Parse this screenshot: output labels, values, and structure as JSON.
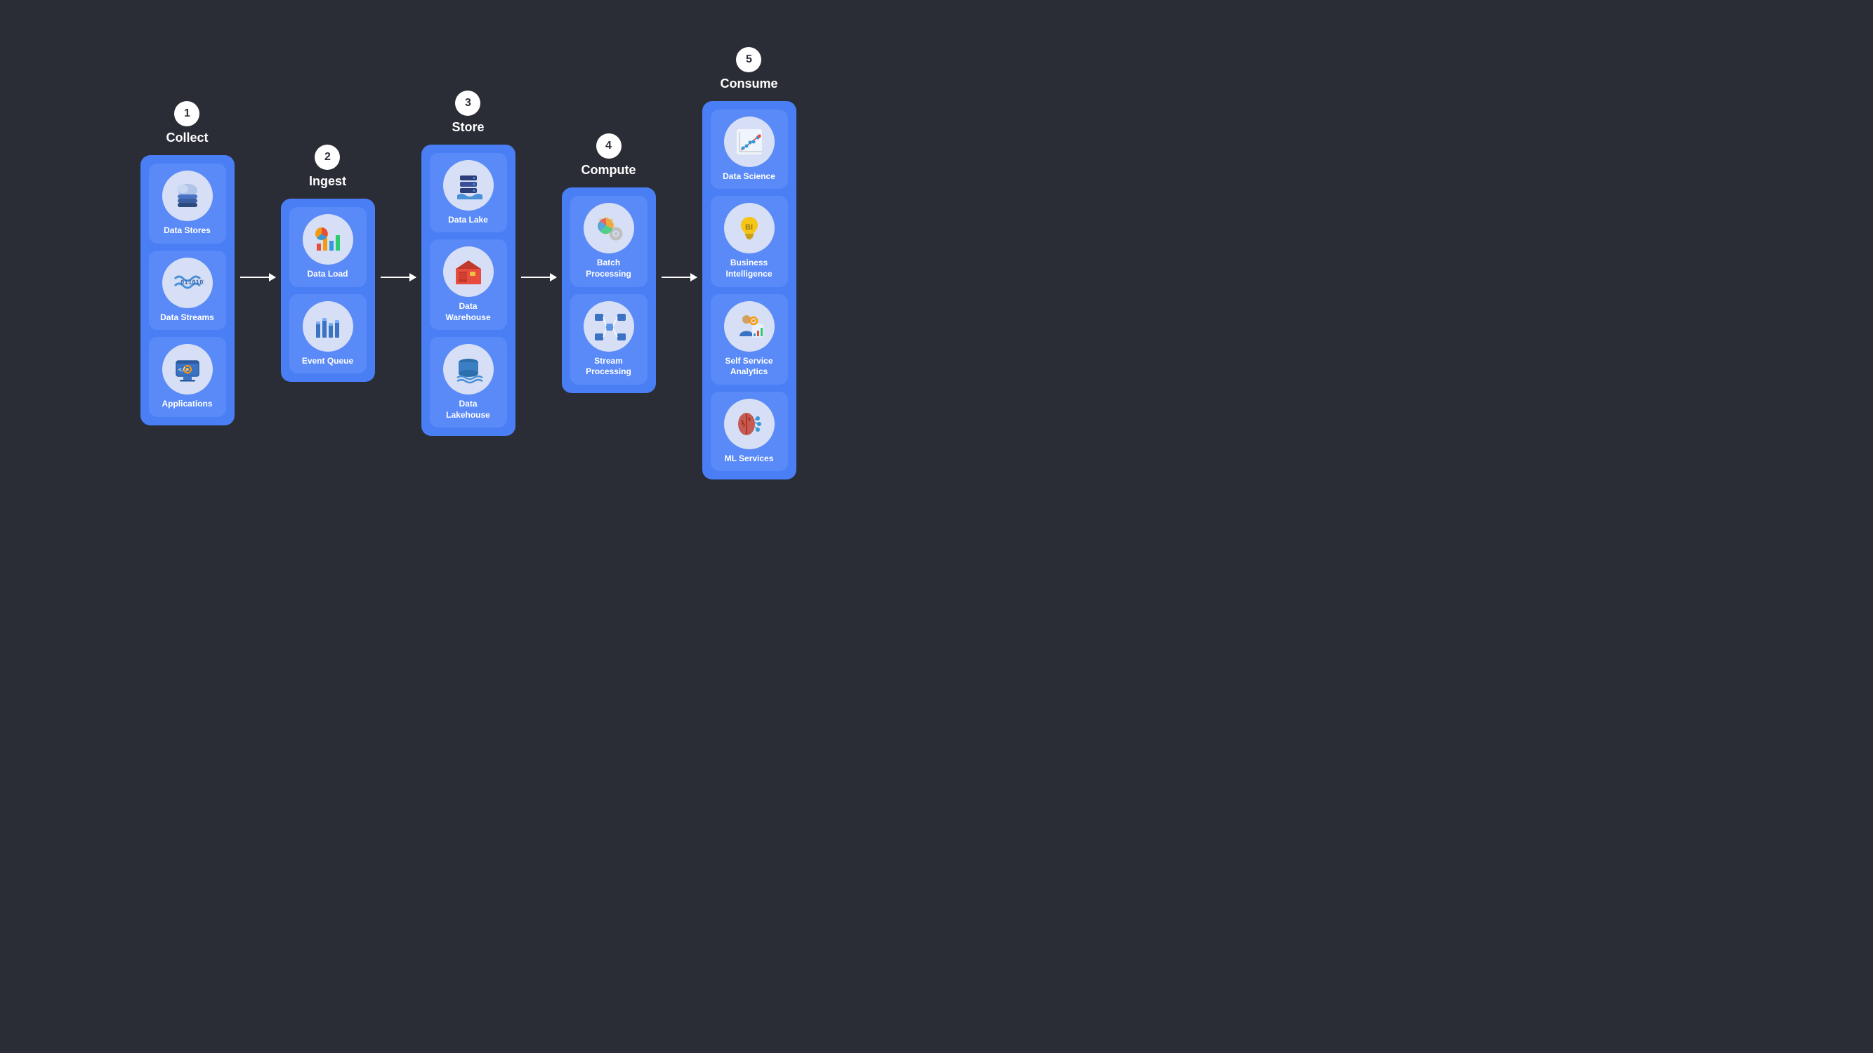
{
  "stages": [
    {
      "number": "1",
      "title": "Collect",
      "items": [
        {
          "label": "Data Stores",
          "icon": "data-stores"
        },
        {
          "label": "Data Streams",
          "icon": "data-streams"
        },
        {
          "label": "Applications",
          "icon": "applications"
        }
      ]
    },
    {
      "number": "2",
      "title": "Ingest",
      "items": [
        {
          "label": "Data Load",
          "icon": "data-load"
        },
        {
          "label": "Event Queue",
          "icon": "event-queue"
        }
      ]
    },
    {
      "number": "3",
      "title": "Store",
      "items": [
        {
          "label": "Data Lake",
          "icon": "data-lake"
        },
        {
          "label": "Data Warehouse",
          "icon": "data-warehouse"
        },
        {
          "label": "Data Lakehouse",
          "icon": "data-lakehouse"
        }
      ]
    },
    {
      "number": "4",
      "title": "Compute",
      "items": [
        {
          "label": "Batch Processing",
          "icon": "batch-processing"
        },
        {
          "label": "Stream Processing",
          "icon": "stream-processing"
        }
      ]
    },
    {
      "number": "5",
      "title": "Consume",
      "items": [
        {
          "label": "Data Science",
          "icon": "data-science"
        },
        {
          "label": "Business Intelligence",
          "icon": "business-intelligence"
        },
        {
          "label": "Self Service Analytics",
          "icon": "self-service-analytics"
        },
        {
          "label": "ML Services",
          "icon": "ml-services"
        }
      ]
    }
  ],
  "arrows": [
    "arrow-1",
    "arrow-2",
    "arrow-3",
    "arrow-4"
  ]
}
